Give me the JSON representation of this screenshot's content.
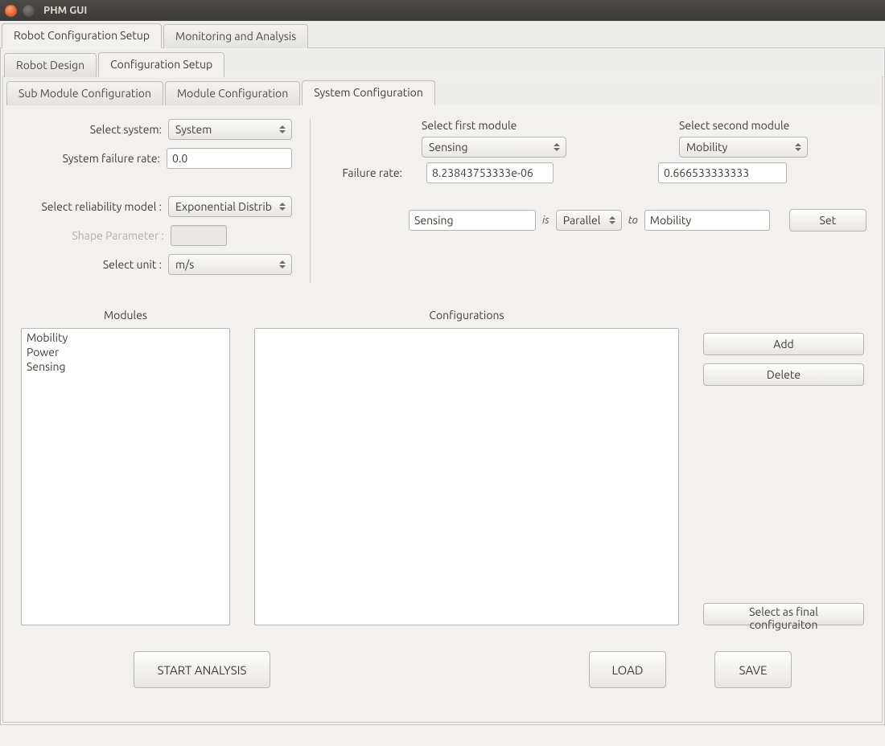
{
  "window": {
    "title": "PHM GUI"
  },
  "tabs_top": {
    "robot_config": "Robot Configuration Setup",
    "monitoring": "Monitoring and Analysis"
  },
  "tabs_mid": {
    "robot_design": "Robot Design",
    "config_setup": "Configuration Setup"
  },
  "tabs_low": {
    "sub_module": "Sub Module Configuration",
    "module": "Module Configuration",
    "system": "System Configuration"
  },
  "left": {
    "select_system_lbl": "Select system:",
    "select_system_val": "System",
    "failure_rate_lbl": "System failure rate:",
    "failure_rate_val": "0.0",
    "reliability_lbl": "Select reliability model :",
    "reliability_val": "Exponential Distribı",
    "shape_lbl": "Shape Parameter :",
    "shape_val": "",
    "unit_lbl": "Select unit :",
    "unit_val": "m/s"
  },
  "right": {
    "first_module_lbl": "Select first module",
    "first_module_val": "Sensing",
    "second_module_lbl": "Select second module",
    "second_module_val": "Mobility",
    "failure_rate_lbl": "Failure rate:",
    "failure_rate_1": "8.23843753333e-06",
    "failure_rate_2": "0.666533333333",
    "rel_a": "Sensing",
    "rel_is": "is",
    "rel_type": "Parallel",
    "rel_to": "to",
    "rel_b": "Mobility",
    "set_btn": "Set"
  },
  "lists": {
    "modules_header": "Modules",
    "configs_header": "Configurations",
    "modules": [
      "Mobility",
      "Power",
      "Sensing"
    ]
  },
  "side_btns": {
    "add": "Add",
    "delete": "Delete",
    "final": "Select as final configuraiton"
  },
  "footer": {
    "start": "START ANALYSIS",
    "load": "LOAD",
    "save": "SAVE"
  }
}
